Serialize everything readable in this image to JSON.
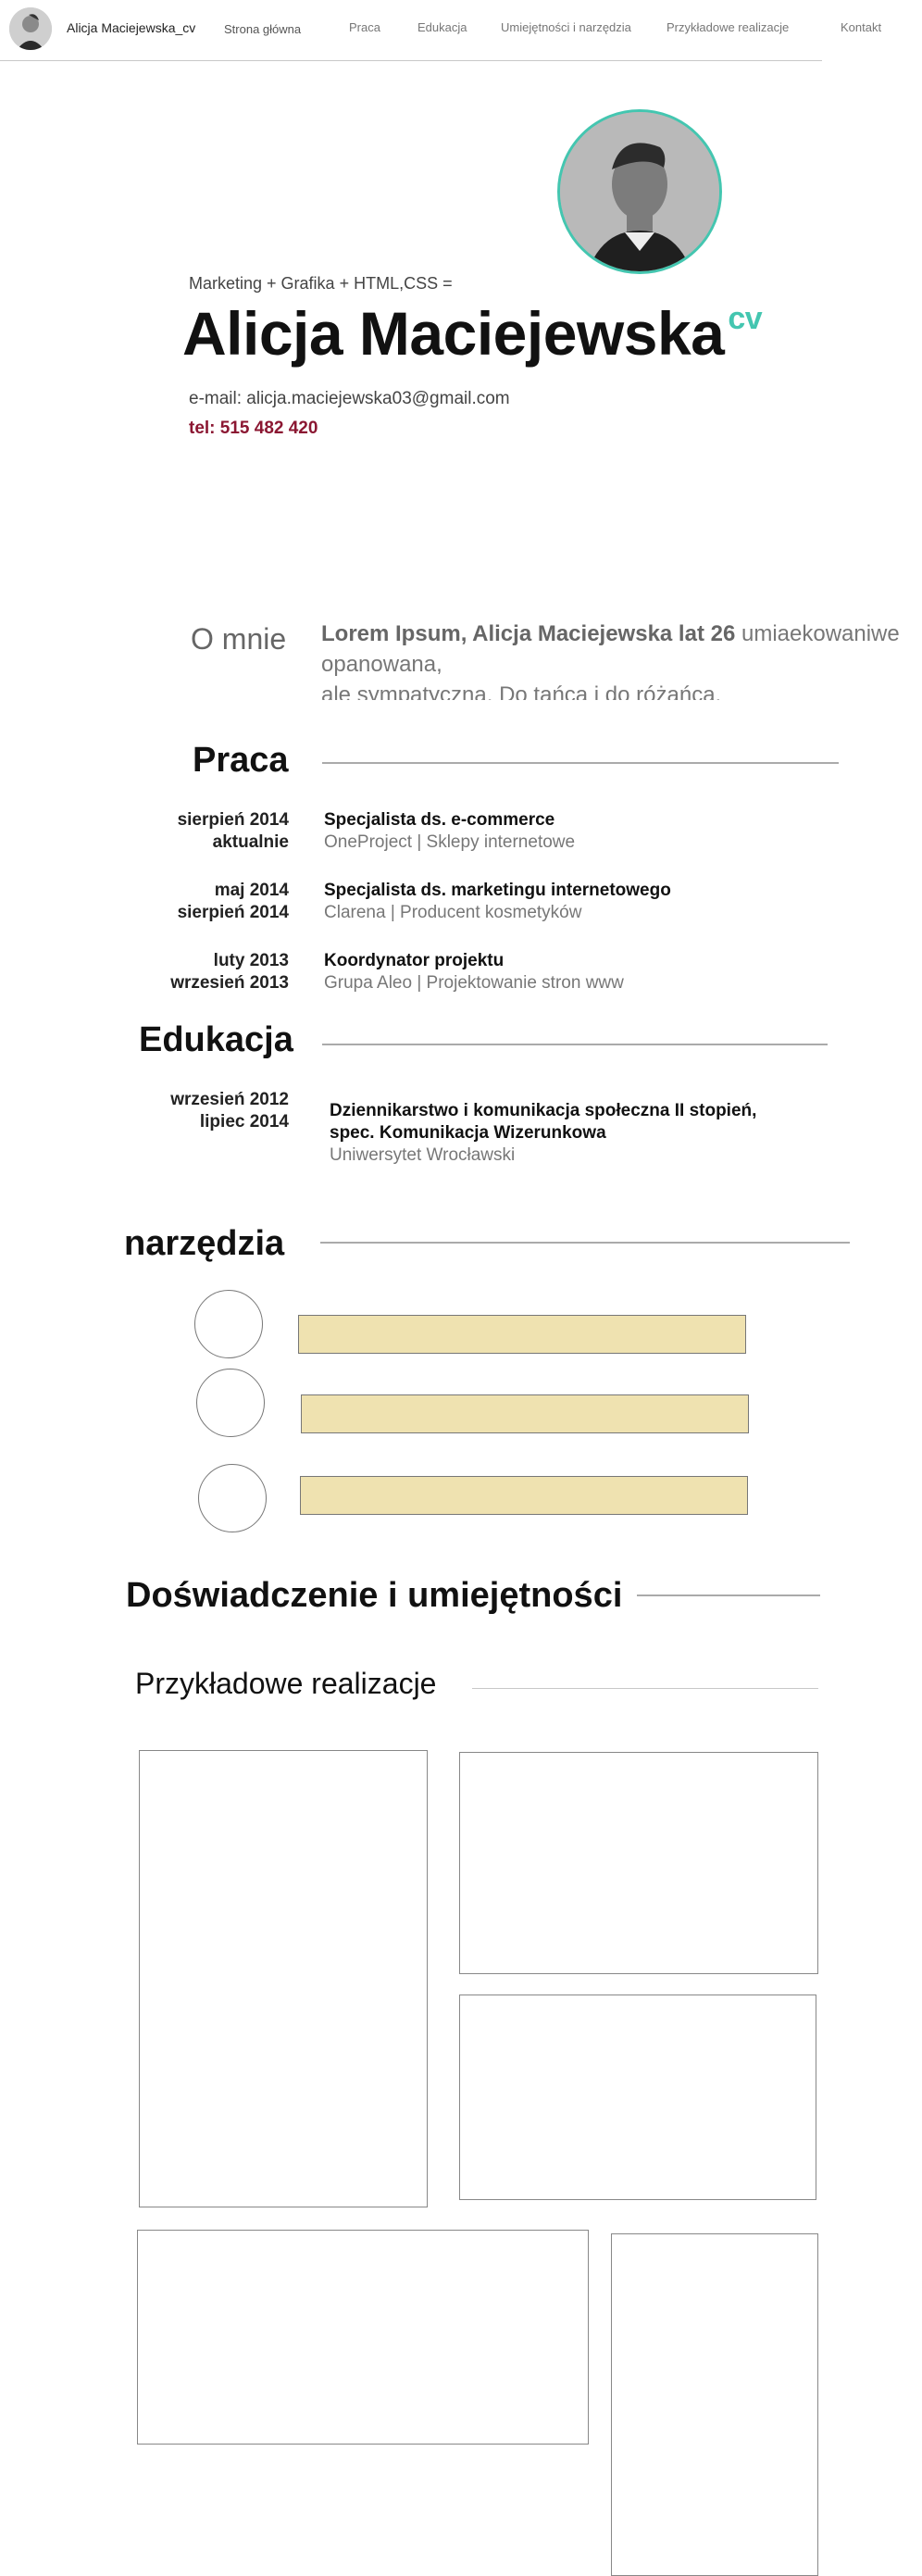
{
  "nav": {
    "brand": "Alicja Maciejewska_cv",
    "links": [
      "Strona główna",
      "Praca",
      "Edukacja",
      "Umiejętności i narzędzia",
      "Przykładowe realizacje",
      "Kontakt"
    ]
  },
  "hero": {
    "subtitle": "Marketing + Grafika + HTML,CSS =",
    "name": "Alicja Maciejewska",
    "name_suffix": "cv",
    "email": "e-mail: alicja.maciejewska03@gmail.com",
    "phone": "tel: 515 482 420"
  },
  "about": {
    "title": "O mnie",
    "bold": "Lorem Ipsum, Alicja Maciejewska lat 26",
    "text": " umiaekowaniwe opanowana,",
    "text2": "ale sympatyczna. Do tańca i do różańca."
  },
  "work": {
    "title": "Praca",
    "items": [
      {
        "date1": "sierpień 2014",
        "date2": "aktualnie",
        "title": "Specjalista ds. e-commerce",
        "sub": "OneProject | Sklepy internetowe"
      },
      {
        "date1": "maj 2014",
        "date2": "sierpień 2014",
        "title": "Specjalista ds. marketingu internetowego",
        "sub": "Clarena | Producent kosmetyków"
      },
      {
        "date1": "luty 2013",
        "date2": "wrzesień 2013",
        "title": "Koordynator projektu",
        "sub": "Grupa Aleo | Projektowanie stron www"
      }
    ]
  },
  "education": {
    "title": "Edukacja",
    "items": [
      {
        "date1": "wrzesień 2012",
        "date2": "lipiec 2014",
        "title1": "Dziennikarstwo i komunikacja społeczna II stopień,",
        "title2": "spec. Komunikacja Wizerunkowa",
        "sub": "Uniwersytet Wrocławski"
      }
    ]
  },
  "tools": {
    "title": "narzędzia"
  },
  "experience": {
    "title": "Doświadczenie i umiejętności"
  },
  "portfolio": {
    "title": "Przykładowe realizacje"
  },
  "colors": {
    "accent": "#44c6b0",
    "phone": "#8b1732",
    "tool_bar": "#efe2b0"
  }
}
